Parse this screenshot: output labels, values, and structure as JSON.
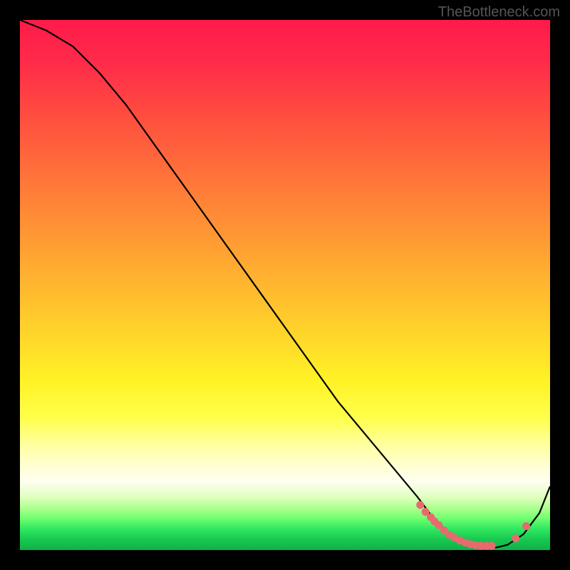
{
  "watermark": "TheBottleneck.com",
  "chart_data": {
    "type": "line",
    "title": "",
    "xlabel": "",
    "ylabel": "",
    "xlim": [
      0,
      100
    ],
    "ylim": [
      0,
      100
    ],
    "series": [
      {
        "name": "curve",
        "x": [
          0,
          5,
          10,
          15,
          20,
          25,
          30,
          35,
          40,
          45,
          50,
          55,
          60,
          65,
          70,
          75,
          78,
          80,
          82,
          85,
          88,
          90,
          92,
          95,
          98,
          100
        ],
        "y": [
          100,
          98,
          95,
          90,
          84,
          77,
          70,
          63,
          56,
          49,
          42,
          35,
          28,
          22,
          16,
          10,
          6,
          4,
          2,
          1,
          0.5,
          0.5,
          1,
          3,
          7,
          12
        ]
      }
    ],
    "dots": {
      "name": "highlight-dots",
      "x": [
        75.5,
        76.5,
        77.5,
        78.2,
        79,
        80,
        81,
        82,
        83,
        84,
        85,
        86,
        87,
        88,
        89,
        93.5,
        95.5
      ],
      "y": [
        8.5,
        7.2,
        6.2,
        5.4,
        4.7,
        3.7,
        2.9,
        2.3,
        1.8,
        1.4,
        1.1,
        0.9,
        0.8,
        0.8,
        0.8,
        2.2,
        4.5
      ]
    }
  }
}
